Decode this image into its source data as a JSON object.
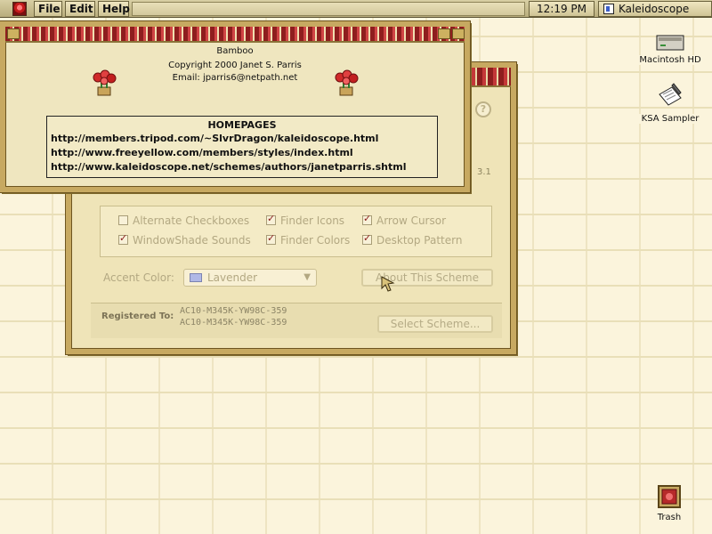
{
  "menubar": {
    "file": "File",
    "edit": "Edit",
    "help": "Help",
    "clock": "12:19 PM",
    "app": "Kaleidoscope"
  },
  "about": {
    "scheme_name": "Bamboo",
    "copyright": "Copyright 2000 Janet S. Parris",
    "email": "Email: jparris6@netpath.net",
    "homepages_title": "HOMEPAGES",
    "urls": [
      "http://members.tripod.com/~SlvrDragon/kaleidoscope.html",
      "http://www.freeyellow.com/members/styles/index.html",
      "http://www.kaleidoscope.net/schemes/authors/janetparris.shtml"
    ]
  },
  "panel": {
    "help_glyph": "?",
    "version": "3.1",
    "options": [
      {
        "label": "Alternate Checkboxes",
        "checked": false
      },
      {
        "label": "Finder Icons",
        "checked": true
      },
      {
        "label": "Arrow Cursor",
        "checked": true
      },
      {
        "label": "WindowShade Sounds",
        "checked": true
      },
      {
        "label": "Finder Colors",
        "checked": true
      },
      {
        "label": "Desktop Pattern",
        "checked": true
      }
    ],
    "accent_label": "Accent Color:",
    "accent_value": "Lavender",
    "about_button": "About This Scheme",
    "registered_label": "Registered To:",
    "registration": [
      "AC10-M345K-YW98C-359",
      "AC10-M345K-YW98C-359"
    ],
    "select_button": "Select Scheme..."
  },
  "desktop": {
    "icons": [
      {
        "label": "Macintosh HD",
        "icon": "hard-disk-icon"
      },
      {
        "label": "KSA Sampler",
        "icon": "document-pen-icon"
      },
      {
        "label": "Trash",
        "icon": "trash-icon"
      }
    ]
  },
  "colors": {
    "accent_red": "#8e1e1e",
    "bamboo": "#c7a961",
    "desktop": "#fbf4dc"
  }
}
